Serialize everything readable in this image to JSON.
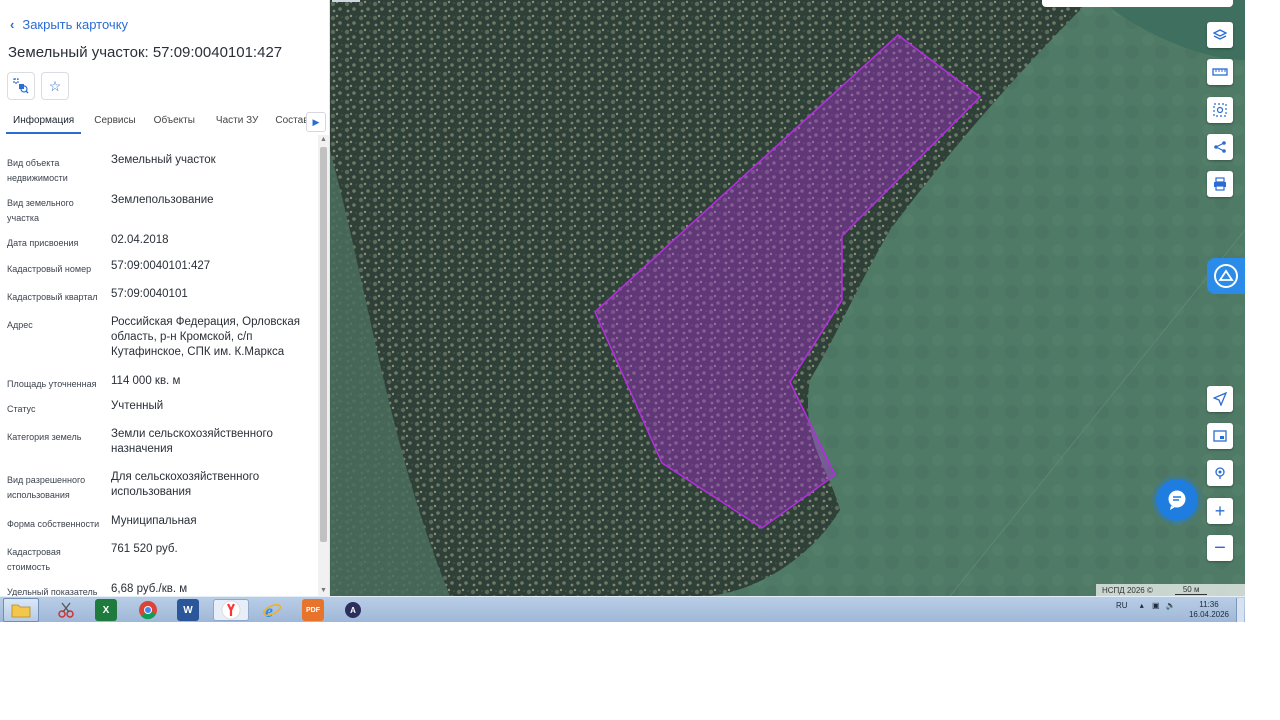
{
  "panel": {
    "close_label": "Закрыть карточку",
    "title": "Земельный участок: 57:09:0040101:427",
    "tabs": [
      "Информация",
      "Сервисы",
      "Объекты",
      "Части ЗУ",
      "Состав"
    ],
    "active_tab": "Информация",
    "properties": [
      {
        "label": "Вид объекта недвижимости",
        "value": "Земельный участок"
      },
      {
        "label": "Вид земельного участка",
        "value": "Землепользование"
      },
      {
        "label": "Дата присвоения",
        "value": "02.04.2018"
      },
      {
        "label": "Кадастровый номер",
        "value": "57:09:0040101:427"
      },
      {
        "label": "Кадастровый квартал",
        "value": "57:09:0040101"
      },
      {
        "label": "Адрес",
        "value": "Российская Федерация, Орловская область, р-н Кромской, с/п Кутафинское, СПК им. К.Маркса"
      },
      {
        "label": "Площадь уточненная",
        "value": "114 000 кв. м"
      },
      {
        "label": "Статус",
        "value": "Учтенный"
      },
      {
        "label": "Категория земель",
        "value": "Земли сельскохозяйственного назначения"
      },
      {
        "label": "Вид разрешенного использования",
        "value": "Для сельскохозяйственного использования"
      },
      {
        "label": "Форма собственности",
        "value": "Муниципальная"
      },
      {
        "label": "Кадастровая стоимость",
        "value": "761 520 руб."
      },
      {
        "label": "Удельный показатель",
        "value": "6,68 руб./кв. м"
      }
    ]
  },
  "map": {
    "attribution": "НСПД 2026 ©",
    "scale_label": "50 м",
    "parcel_color": "#b42ee0",
    "buttons": [
      "layers-icon",
      "ruler-icon",
      "select-area-icon",
      "share-icon",
      "print-icon",
      "locate-icon",
      "minimap-icon",
      "geo-pin-icon",
      "zoom-in-icon",
      "zoom-out-icon"
    ]
  },
  "taskbar": {
    "apps": [
      "explorer",
      "scissors",
      "excel",
      "chrome",
      "word",
      "yandex",
      "ie",
      "pdf",
      "alice"
    ],
    "lang": "RU",
    "time": "11:36",
    "date": "16.04.2026"
  }
}
